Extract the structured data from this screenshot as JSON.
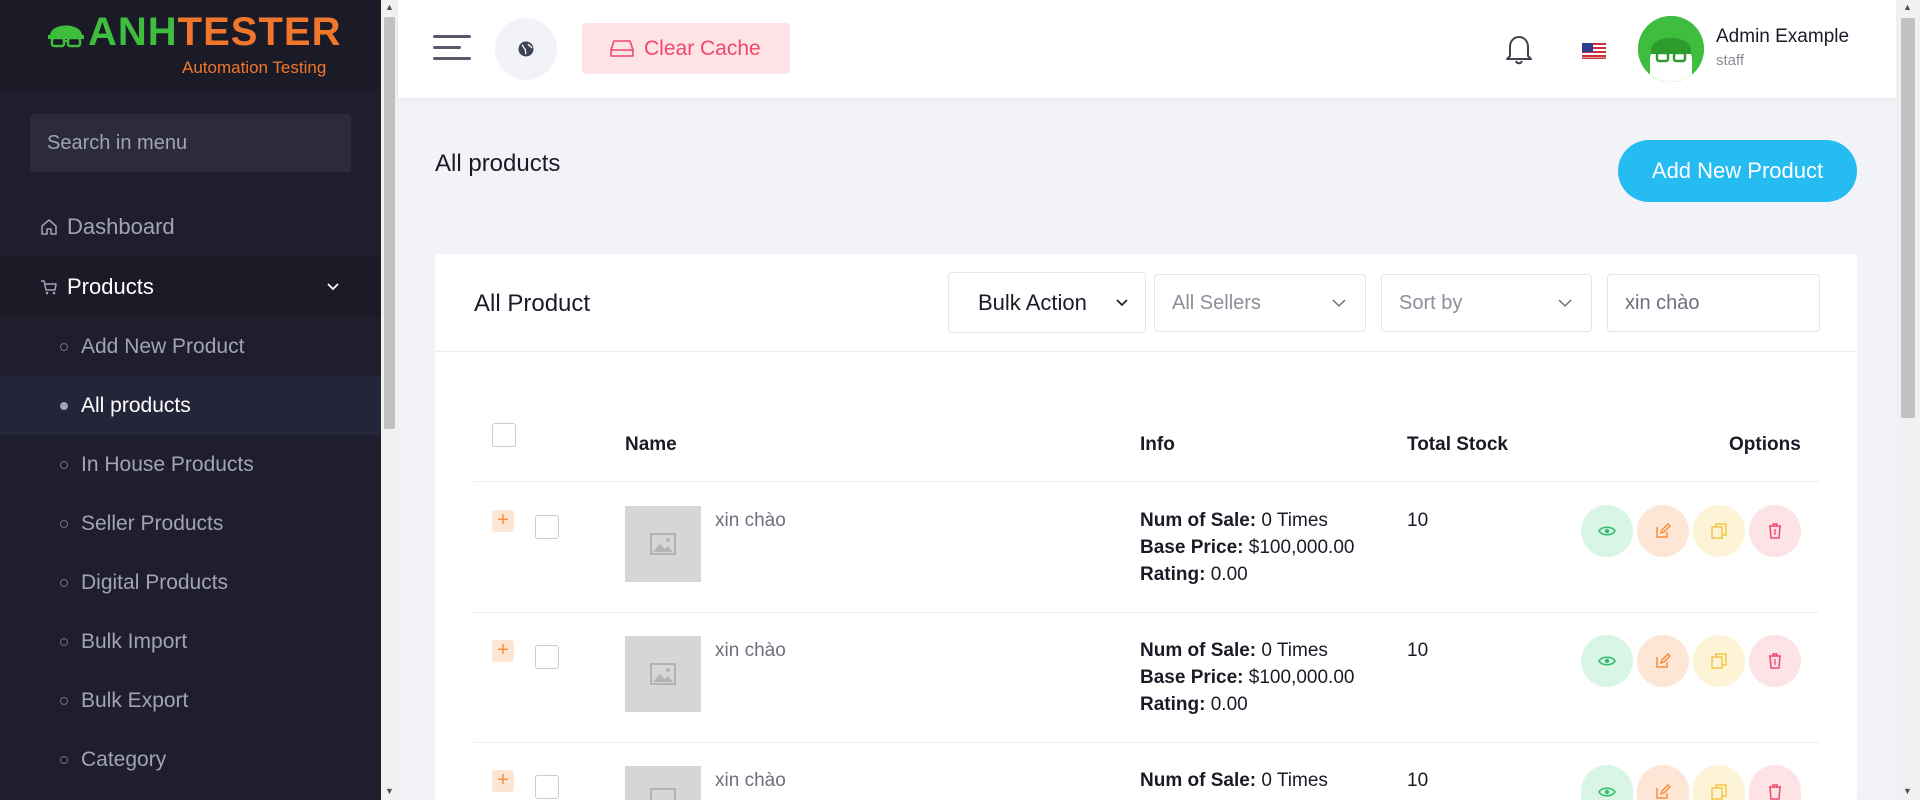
{
  "brand": {
    "part1": "ANH",
    "part2": "TESTER",
    "subtitle": "Automation Testing"
  },
  "sidebar": {
    "search_placeholder": "Search in menu",
    "menu": [
      {
        "label": "Dashboard",
        "icon": "home-icon"
      },
      {
        "label": "Products",
        "icon": "cart-icon",
        "expanded": true
      }
    ],
    "submenu": [
      {
        "label": "Add New Product",
        "active": false
      },
      {
        "label": "All products",
        "active": true
      },
      {
        "label": "In House Products",
        "active": false
      },
      {
        "label": "Seller Products",
        "active": false
      },
      {
        "label": "Digital Products",
        "active": false
      },
      {
        "label": "Bulk Import",
        "active": false
      },
      {
        "label": "Bulk Export",
        "active": false
      },
      {
        "label": "Category",
        "active": false
      }
    ]
  },
  "topbar": {
    "clear_cache": "Clear Cache",
    "user_name": "Admin Example",
    "user_role": "staff"
  },
  "page": {
    "title": "All products",
    "add_button": "Add New Product"
  },
  "card": {
    "title": "All Product",
    "bulk_action": "Bulk Action",
    "sellers_select": "All Sellers",
    "sort_select": "Sort by",
    "search_value": "xin chào"
  },
  "table": {
    "headers": {
      "name": "Name",
      "info": "Info",
      "stock": "Total Stock",
      "options": "Options"
    },
    "info_labels": {
      "sale": "Num of Sale:",
      "price": "Base Price:",
      "rating": "Rating:"
    },
    "rows": [
      {
        "name": "xin chào",
        "sale": "0 Times",
        "price": "$100,000.00",
        "rating": "0.00",
        "stock": "10"
      },
      {
        "name": "xin chào",
        "sale": "0 Times",
        "price": "$100,000.00",
        "rating": "0.00",
        "stock": "10"
      },
      {
        "name": "xin chào",
        "sale": "0 Times",
        "price": "",
        "rating": "",
        "stock": "10"
      }
    ]
  },
  "colors": {
    "sidebar_bg": "#1e1e2d",
    "accent_blue": "#25bcf1",
    "danger": "#ef486a",
    "view_green": "#2fbd6b",
    "edit_orange": "#f58d3c",
    "copy_yellow": "#f6c544"
  }
}
